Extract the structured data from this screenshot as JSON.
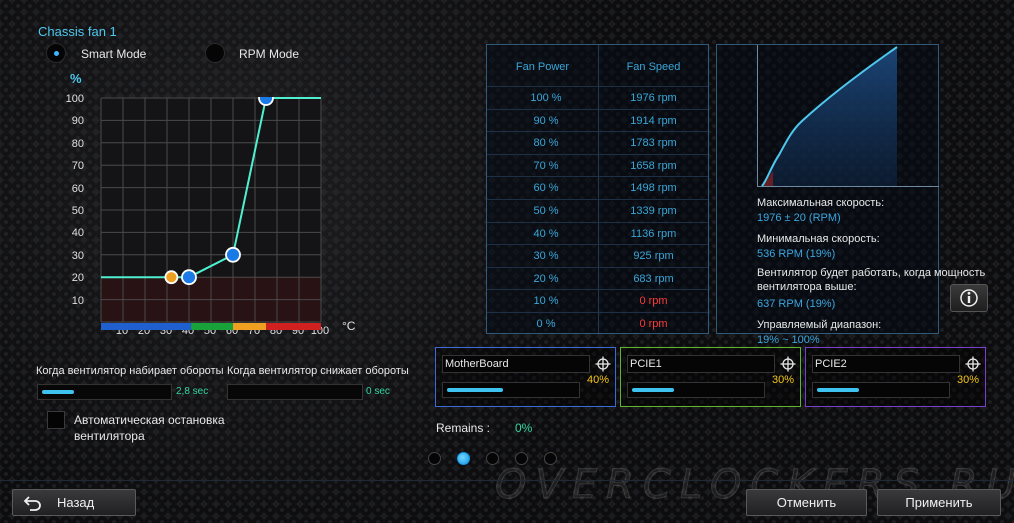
{
  "header": {
    "title": "Chassis fan 1"
  },
  "modes": {
    "smart": "Smart Mode",
    "rpm": "RPM Mode",
    "selected": "smart"
  },
  "curve_chart": {
    "y_unit": "%",
    "x_unit": "°C",
    "y_ticks": [
      "100",
      "90",
      "80",
      "70",
      "60",
      "50",
      "40",
      "30",
      "20",
      "10"
    ],
    "x_ticks": [
      "10",
      "20",
      "30",
      "40",
      "50",
      "60",
      "70",
      "80",
      "90",
      "100"
    ],
    "points": [
      {
        "temp": 0,
        "pct": 20
      },
      {
        "temp": 32,
        "pct": 20
      },
      {
        "temp": 40,
        "pct": 20
      },
      {
        "temp": 60,
        "pct": 30
      },
      {
        "temp": 75,
        "pct": 100
      },
      {
        "temp": 100,
        "pct": 100
      }
    ],
    "zone_colors": [
      "#1f5fd0",
      "#1aa23a",
      "#f0a020",
      "#d02020"
    ]
  },
  "spin": {
    "up_label": "Когда вентилятор набирает обороты",
    "up_value": "2,8 sec",
    "up_fill": 0.25,
    "down_label": "Когда вентилятор снижает обороты",
    "down_value": "0 sec",
    "down_fill": 0
  },
  "auto_stop": {
    "line1": "Автоматическая остановка",
    "line2": "вентилятора",
    "checked": false
  },
  "table": {
    "headers": [
      "Fan Power",
      "Fan Speed"
    ],
    "rows": [
      [
        "100 %",
        "1976 rpm"
      ],
      [
        "90 %",
        "1914 rpm"
      ],
      [
        "80 %",
        "1783 rpm"
      ],
      [
        "70 %",
        "1658 rpm"
      ],
      [
        "60 %",
        "1498 rpm"
      ],
      [
        "50 %",
        "1339 rpm"
      ],
      [
        "40 %",
        "1136 rpm"
      ],
      [
        "30 %",
        "925 rpm"
      ],
      [
        "20 %",
        "683 rpm"
      ],
      [
        "10 %",
        "0 rpm"
      ],
      [
        "0 %",
        "0 rpm"
      ]
    ]
  },
  "info": {
    "max_label": "Максимальная скорость:",
    "max_value": "1976 ± 20 (RPM)",
    "min_label": "Минимальная скорость:",
    "min_value": "536 RPM (19%)",
    "start_label_1": "Вентилятор будет работать, когда мощность",
    "start_label_2": "вентилятора выше:",
    "start_value": "637 RPM (19%)",
    "range_label": "Управляемый диапазон:",
    "range_value": "19% ~ 100%"
  },
  "sources": [
    {
      "name": "MotherBoard",
      "percent": "40%",
      "fill": 0.4,
      "color": "#3b6bd6"
    },
    {
      "name": "PCIE1",
      "percent": "30%",
      "fill": 0.3,
      "color": "#5fb52c"
    },
    {
      "name": "PCIE2",
      "percent": "30%",
      "fill": 0.3,
      "color": "#7a3fc9"
    }
  ],
  "remains": {
    "label": "Remains :",
    "value": "0%"
  },
  "pagination": {
    "count": 5,
    "active": 1
  },
  "watermark": "OVERCLOCKERS.RU",
  "footer": {
    "back": "Назад",
    "cancel": "Отменить",
    "apply": "Применить"
  }
}
